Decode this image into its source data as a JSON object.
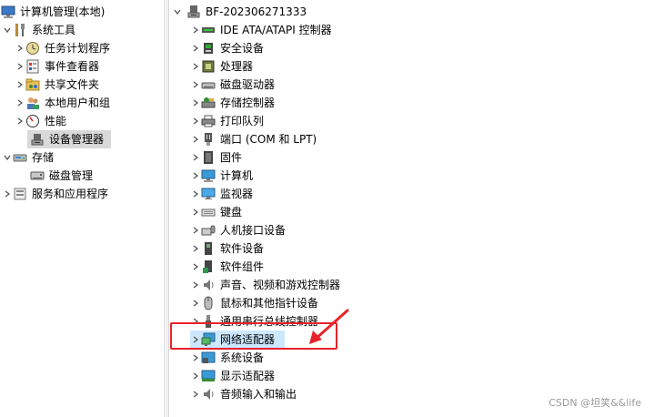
{
  "left_tree": {
    "items": [
      {
        "label": "计算机管理(本地)",
        "icon": "computer-mgmt-icon",
        "expanded": true
      },
      {
        "label": "系统工具",
        "icon": "tools-icon",
        "expanded": true
      },
      {
        "label": "任务计划程序",
        "icon": "clock-icon"
      },
      {
        "label": "事件查看器",
        "icon": "event-viewer-icon"
      },
      {
        "label": "共享文件夹",
        "icon": "shared-folder-icon"
      },
      {
        "label": "本地用户和组",
        "icon": "users-icon"
      },
      {
        "label": "性能",
        "icon": "performance-icon"
      },
      {
        "label": "设备管理器",
        "icon": "device-manager-icon"
      },
      {
        "label": "存储",
        "icon": "storage-icon",
        "expanded": true
      },
      {
        "label": "磁盘管理",
        "icon": "disk-mgmt-icon"
      },
      {
        "label": "服务和应用程序",
        "icon": "services-icon"
      }
    ]
  },
  "device_tree": {
    "root": {
      "label": "BF-202306271333",
      "icon": "computer-root-icon"
    },
    "categories": [
      {
        "label": "IDE ATA/ATAPI 控制器",
        "icon": "ide-controller-icon"
      },
      {
        "label": "安全设备",
        "icon": "security-device-icon"
      },
      {
        "label": "处理器",
        "icon": "processor-icon"
      },
      {
        "label": "磁盘驱动器",
        "icon": "disk-drive-icon"
      },
      {
        "label": "存储控制器",
        "icon": "storage-controller-icon"
      },
      {
        "label": "打印队列",
        "icon": "printer-icon"
      },
      {
        "label": "端口 (COM 和 LPT)",
        "icon": "port-icon"
      },
      {
        "label": "固件",
        "icon": "firmware-icon"
      },
      {
        "label": "计算机",
        "icon": "computer-icon"
      },
      {
        "label": "监视器",
        "icon": "monitor-icon"
      },
      {
        "label": "键盘",
        "icon": "keyboard-icon"
      },
      {
        "label": "人机接口设备",
        "icon": "hid-icon"
      },
      {
        "label": "软件设备",
        "icon": "software-device-icon"
      },
      {
        "label": "软件组件",
        "icon": "software-component-icon"
      },
      {
        "label": "声音、视频和游戏控制器",
        "icon": "sound-icon"
      },
      {
        "label": "鼠标和其他指针设备",
        "icon": "mouse-icon"
      },
      {
        "label": "通用串行总线控制器",
        "icon": "usb-icon"
      },
      {
        "label": "网络适配器",
        "icon": "network-adapter-icon"
      },
      {
        "label": "系统设备",
        "icon": "system-device-icon"
      },
      {
        "label": "显示适配器",
        "icon": "display-adapter-icon"
      },
      {
        "label": "音频输入和输出",
        "icon": "audio-io-icon"
      }
    ]
  },
  "watermark": "CSDN @坦笑&&life",
  "colors": {
    "highlight_box": "#e8222a",
    "selected_bg": "#d9d9d9",
    "hover_bg": "#cce8ff"
  }
}
